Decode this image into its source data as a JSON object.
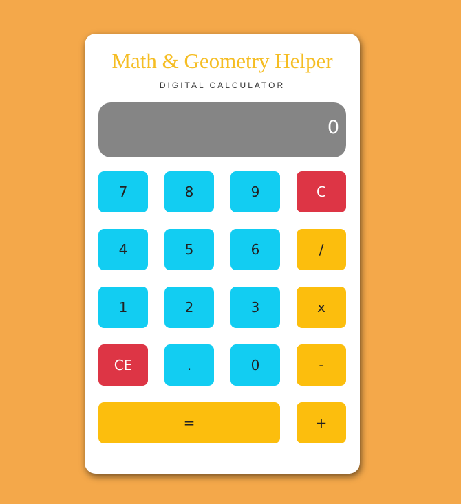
{
  "header": {
    "title": "Math & Geometry Helper",
    "subtitle": "DIGITAL CALCULATOR"
  },
  "display": {
    "value": "0"
  },
  "keys": {
    "seven": "7",
    "eight": "8",
    "nine": "9",
    "clear": "C",
    "four": "4",
    "five": "5",
    "six": "6",
    "divide": "/",
    "one": "1",
    "two": "2",
    "three": "3",
    "multiply": "x",
    "clear_entry": "CE",
    "decimal": ".",
    "zero": "0",
    "subtract": "-",
    "equals": "=",
    "add": "+"
  },
  "colors": {
    "background": "#f4a84a",
    "title": "#f5bd23",
    "display": "#858585",
    "number_key": "#12cdf2",
    "operator_key": "#fcbe0d",
    "clear_key": "#dd3545"
  }
}
